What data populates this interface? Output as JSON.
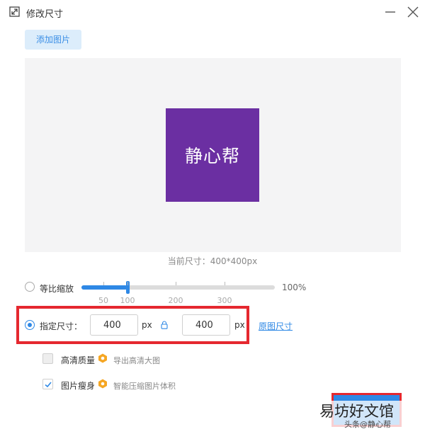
{
  "window": {
    "title": "修改尺寸",
    "icons": {
      "app": "resize-icon",
      "minimize": "minimize-icon",
      "close": "close-icon"
    }
  },
  "toolbar": {
    "add_image_label": "添加图片"
  },
  "preview": {
    "image_text": "静心帮",
    "image_color": "#6b2fa2",
    "current_size_label": "当前尺寸：400*400px"
  },
  "scale_option": {
    "label": "等比缩放",
    "selected": false,
    "slider_value_percent": 100,
    "slider_min": 0,
    "slider_max": 300,
    "tick_labels": [
      "50",
      "100",
      "200",
      "300"
    ],
    "value_label": "100%"
  },
  "size_option": {
    "label": "指定尺寸：",
    "selected": true,
    "width_value": "400",
    "height_value": "400",
    "unit": "px",
    "lock_icon": "lock-icon",
    "original_size_link": "原图尺寸"
  },
  "hd_option": {
    "label": "高清质量",
    "checked": false,
    "description": "导出高清大图"
  },
  "slim_option": {
    "label": "图片瘦身",
    "checked": true,
    "description": "智能压缩图片体积"
  },
  "watermark": {
    "main": "易坊好文馆",
    "sub": "头条@静心帮"
  },
  "colors": {
    "accent": "#2e88e5",
    "highlight_border": "#e5282f",
    "hint_icon": "#f5a623"
  }
}
